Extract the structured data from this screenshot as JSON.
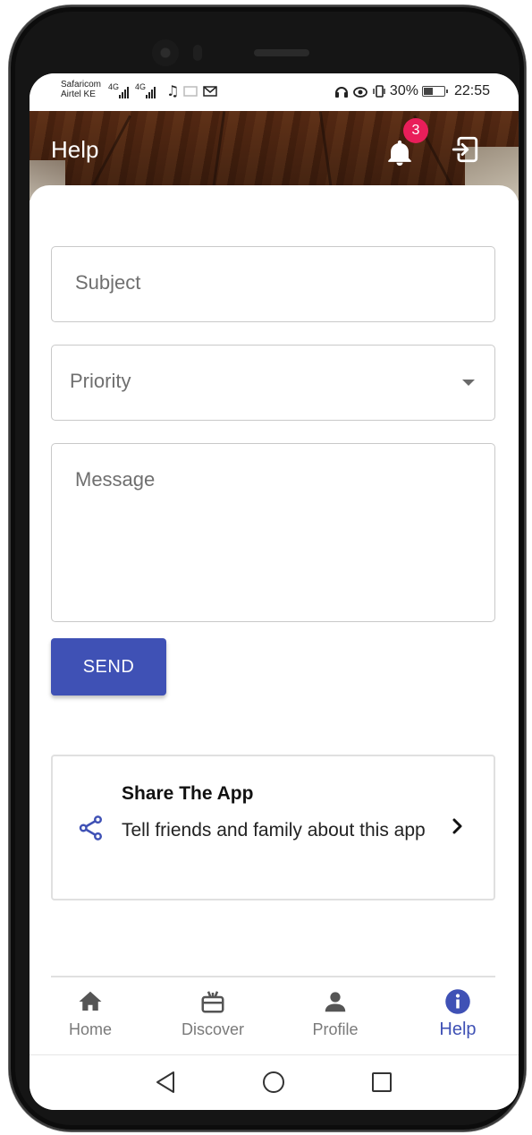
{
  "status_bar": {
    "carrier_1": "Safaricom",
    "carrier_2": "Airtel KE",
    "net_1": "4G",
    "net_2": "4G",
    "battery_percent": "30%",
    "time": "22:55",
    "icons": [
      "music-note-icon",
      "cast-icon",
      "mail-icon",
      "headset-icon",
      "eye-icon",
      "vibrate-icon",
      "battery-icon"
    ]
  },
  "header": {
    "title": "Help",
    "notification_count": "3",
    "icons": [
      "bell-icon",
      "logout-icon"
    ],
    "badge_color": "#e91e5a"
  },
  "form": {
    "subject_placeholder": "Subject",
    "priority_placeholder": "Priority",
    "message_placeholder": "Message",
    "send_label": "SEND"
  },
  "share": {
    "title": "Share The App",
    "subtitle": "Tell friends and family about this app",
    "icon": "share-icon"
  },
  "bottom_nav": {
    "items": [
      {
        "label": "Home",
        "icon": "home-icon"
      },
      {
        "label": "Discover",
        "icon": "gift-icon"
      },
      {
        "label": "Profile",
        "icon": "person-icon"
      },
      {
        "label": "Help",
        "icon": "info-icon"
      }
    ],
    "active": "Help"
  },
  "colors": {
    "accent": "#3f51b5",
    "badge": "#e91e5a"
  }
}
